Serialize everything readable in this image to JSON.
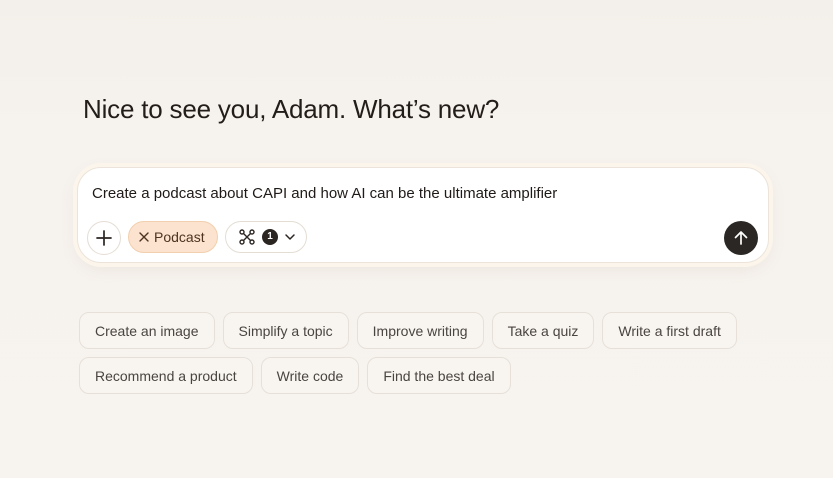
{
  "greeting": "Nice to see you, Adam. What’s new?",
  "composer": {
    "input_text": "Create a podcast about CAPI and how AI can be the ultimate amplifier",
    "add_icon": "plus-icon",
    "mode_chip": {
      "label": "Podcast",
      "remove_icon": "close-icon"
    },
    "tools": {
      "icon": "connectors-icon",
      "count": "1",
      "chevron_icon": "chevron-down-icon"
    },
    "send_icon": "arrow-up-icon"
  },
  "suggestions": {
    "row1": [
      {
        "label": "Create an image"
      },
      {
        "label": "Simplify a topic"
      },
      {
        "label": "Improve writing"
      },
      {
        "label": "Take a quiz"
      },
      {
        "label": "Write a first draft"
      }
    ],
    "row2": [
      {
        "label": "Recommend a product"
      },
      {
        "label": "Write code"
      },
      {
        "label": "Find the best deal"
      }
    ]
  },
  "colors": {
    "background": "#f6f2ed",
    "chip_accent": "#fbe3cf",
    "send_button": "#2b2724"
  }
}
